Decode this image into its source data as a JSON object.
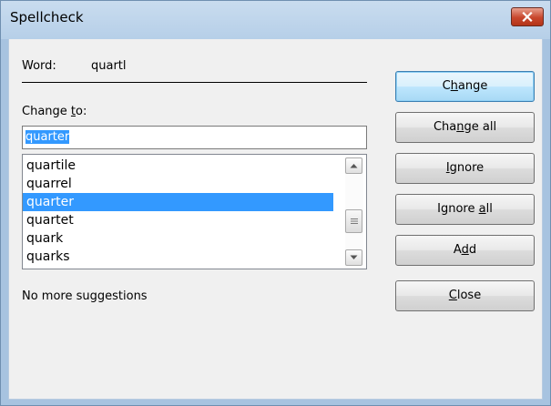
{
  "window": {
    "title": "Spellcheck"
  },
  "word": {
    "label": "Word:",
    "value": "quartl"
  },
  "change_to": {
    "label_before": "Change ",
    "label_accel": "t",
    "label_after": "o:",
    "value": "quarter"
  },
  "suggestions": {
    "items": [
      "quartile",
      "quarrel",
      "quarter",
      "quartet",
      "quark",
      "quarks"
    ],
    "selected": "quarter"
  },
  "status": {
    "text": "No more suggestions"
  },
  "buttons": {
    "change": {
      "before": "C",
      "accel": "h",
      "after": "ange"
    },
    "change_all": {
      "before": "Cha",
      "accel": "n",
      "after": "ge all"
    },
    "ignore": {
      "before": "",
      "accel": "I",
      "after": "gnore"
    },
    "ignore_all": {
      "before": "Ignore ",
      "accel": "a",
      "after": "ll"
    },
    "add": {
      "before": "A",
      "accel": "d",
      "after": "d"
    },
    "close": {
      "before": "",
      "accel": "C",
      "after": "lose"
    }
  },
  "icons": {
    "close": "close-x-icon",
    "scroll_up": "scroll-up-arrow-icon",
    "scroll_down": "scroll-down-arrow-icon",
    "grip": "scroll-grip-icon"
  },
  "colors": {
    "selection": "#3399ff",
    "default_button_border": "#3c7fb1",
    "close_button": "#c8462c"
  }
}
